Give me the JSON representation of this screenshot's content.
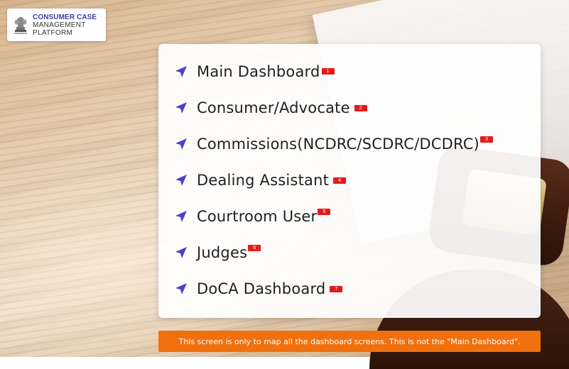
{
  "logo": {
    "line1": "CONSUMER CASE",
    "line2": "MANAGEMENT",
    "line3": "PLATFORM",
    "emblem_icon": "state-emblem-icon",
    "brand_color": "#3a3f9e"
  },
  "menu": {
    "items": [
      {
        "label": "Main Dashboard",
        "badge": "1",
        "icon": "send-arrow-icon"
      },
      {
        "label": "Consumer/Advocate",
        "badge": "2",
        "icon": "send-arrow-icon"
      },
      {
        "label": "Commissions(NCDRC/SCDRC/DCDRC)",
        "badge": "3",
        "icon": "send-arrow-icon"
      },
      {
        "label": "Dealing Assistant",
        "badge": "4",
        "icon": "send-arrow-icon"
      },
      {
        "label": "Courtroom User",
        "badge": "5",
        "icon": "send-arrow-icon"
      },
      {
        "label": "Judges",
        "badge": "6",
        "icon": "send-arrow-icon"
      },
      {
        "label": "DoCA Dashboard",
        "badge": "7",
        "icon": "send-arrow-icon"
      }
    ],
    "icon_color": "#4b3fcf",
    "badge_color": "#e31b1b"
  },
  "notice": {
    "text": "This screen is only to map all the dashboard screens. This is not the \"Main Dashboard\".",
    "color": "#f0700e"
  }
}
